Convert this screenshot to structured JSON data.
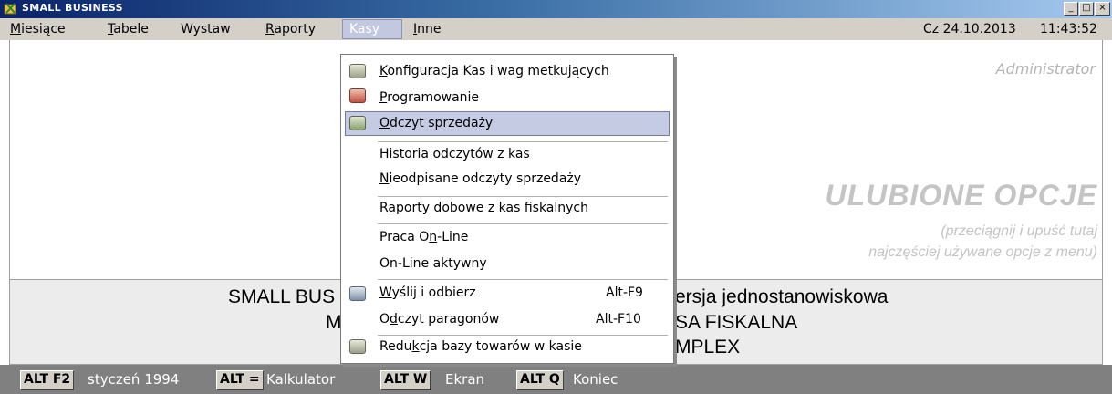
{
  "window": {
    "title": "SMALL BUSINESS",
    "controls": [
      "_",
      "□",
      "×"
    ]
  },
  "menubar": {
    "items": [
      {
        "label": "Miesiące",
        "key": "M",
        "rest": "iesiące"
      },
      {
        "label": "Tabele",
        "key": "T",
        "rest": "abele"
      },
      {
        "label": "Wystaw",
        "key": "",
        "rest": "Wystaw"
      },
      {
        "label": "Raporty",
        "key": "R",
        "rest": "aporty"
      },
      {
        "label": "Kasy",
        "key": "",
        "rest": "Kasy"
      },
      {
        "label": "Inne",
        "key": "I",
        "rest": "nne"
      }
    ],
    "date": "Cz 24.10.2013",
    "time": "11:43:52"
  },
  "workspace": {
    "user": "Administrator",
    "favorites_title": "ULUBIONE OPCJE",
    "favorites_hint_1": "(przeciągnij i upuść tutaj",
    "favorites_hint_2": "najczęściej używane opcje z menu)"
  },
  "info_panel": {
    "line1_left": "SMALL BUS",
    "line1_right": "ersja jednostanowiskowa",
    "line2_left": "M",
    "line2_right": "SA FISKALNA",
    "line3_right": "MPLEX"
  },
  "dropdown": {
    "items": [
      {
        "pre": "",
        "u": "K",
        "post": "onfiguracja Kas i wag metkujących",
        "shortcut": ""
      },
      {
        "pre": "",
        "u": "P",
        "post": "rogramowanie",
        "shortcut": ""
      },
      {
        "pre": "",
        "u": "O",
        "post": "dczyt sprzedaży",
        "shortcut": ""
      },
      {
        "pre": "Historia odczytów z kas",
        "u": "",
        "post": "",
        "shortcut": ""
      },
      {
        "pre": "",
        "u": "N",
        "post": "ieodpisane odczyty sprzedaży",
        "shortcut": ""
      },
      {
        "pre": "",
        "u": "R",
        "post": "aporty dobowe z kas fiskalnych",
        "shortcut": ""
      },
      {
        "pre": "Praca O",
        "u": "n",
        "post": "-Line",
        "shortcut": ""
      },
      {
        "pre": "On-Line aktywny",
        "u": "",
        "post": "",
        "shortcut": ""
      },
      {
        "pre": "",
        "u": "W",
        "post": "yślij i odbierz",
        "shortcut": "Alt-F9"
      },
      {
        "pre": "O",
        "u": "d",
        "post": "czyt paragonów",
        "shortcut": "Alt-F10"
      },
      {
        "pre": "Redu",
        "u": "k",
        "post": "cja bazy towarów w kasie",
        "shortcut": ""
      }
    ]
  },
  "statusbar": {
    "keys": [
      {
        "key": "ALT F2",
        "label": "styczeń 1994"
      },
      {
        "key": "ALT =",
        "label": "Kalkulator"
      },
      {
        "key": "ALT W",
        "label": "Ekran"
      },
      {
        "key": "ALT Q",
        "label": "Koniec"
      }
    ]
  },
  "colors": {
    "title_bar": "#0a246a",
    "highlight": "#c5cbe2",
    "status_bar": "#808080"
  }
}
